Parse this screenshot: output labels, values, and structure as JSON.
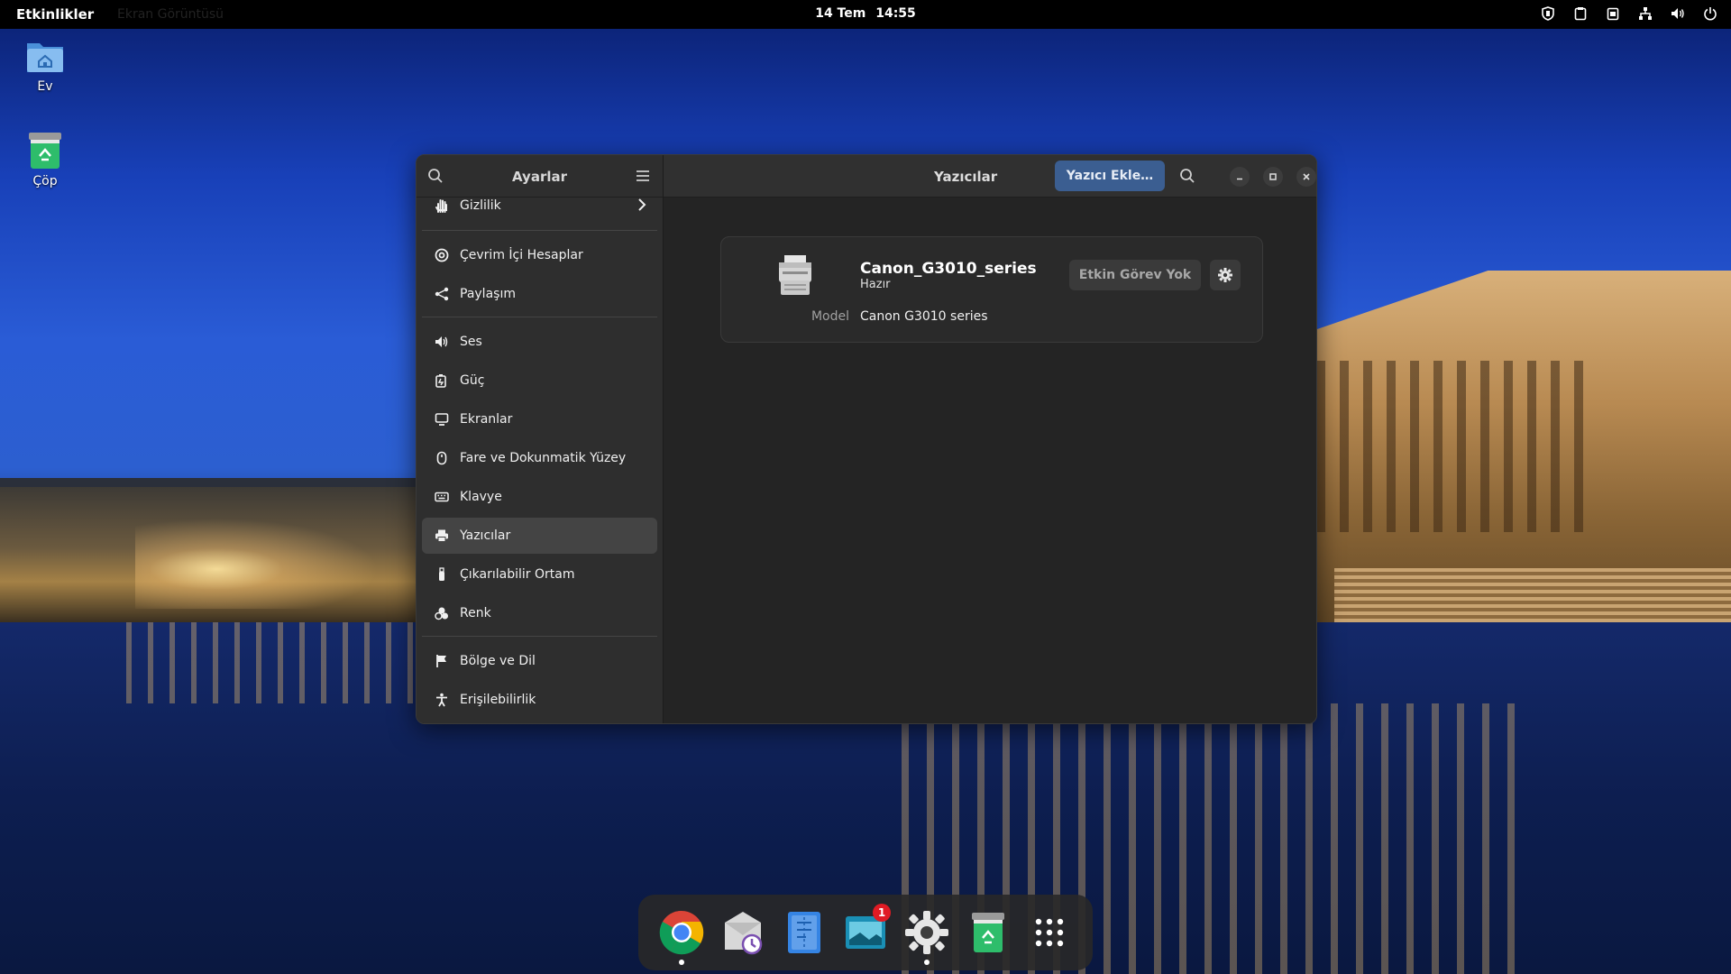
{
  "topbar": {
    "activities": "Etkinlikler",
    "ghost_label": "Ekran Görüntüsü",
    "date": "14 Tem",
    "time": "14:55"
  },
  "desktop": {
    "icons": [
      {
        "label": "Ev",
        "icon": "home-folder-icon"
      },
      {
        "label": "Çöp",
        "icon": "trash-icon"
      }
    ]
  },
  "settings": {
    "sidebar_title": "Ayarlar",
    "items": [
      {
        "label": "Gizlilik",
        "icon": "privacy-hand-icon"
      },
      {
        "label": "Çevrim İçi Hesaplar",
        "icon": "at-icon"
      },
      {
        "label": "Paylaşım",
        "icon": "share-icon"
      },
      {
        "label": "Ses",
        "icon": "speaker-icon"
      },
      {
        "label": "Güç",
        "icon": "battery-icon"
      },
      {
        "label": "Ekranlar",
        "icon": "display-icon"
      },
      {
        "label": "Fare ve Dokunmatik Yüzey",
        "icon": "mouse-icon"
      },
      {
        "label": "Klavye",
        "icon": "keyboard-icon"
      },
      {
        "label": "Yazıcılar",
        "icon": "printer-icon",
        "active": true
      },
      {
        "label": "Çıkarılabilir Ortam",
        "icon": "usb-icon"
      },
      {
        "label": "Renk",
        "icon": "color-icon"
      },
      {
        "label": "Bölge ve Dil",
        "icon": "flag-icon"
      },
      {
        "label": "Erişilebilirlik",
        "icon": "accessibility-icon"
      }
    ],
    "header": {
      "title": "Yazıcılar",
      "add_button": "Yazıcı Ekle…"
    },
    "printer": {
      "name": "Canon_G3010_series",
      "status": "Hazır",
      "jobs_button": "Etkin Görev Yok",
      "model_label": "Model",
      "model_value": "Canon G3010 series"
    }
  },
  "dock": {
    "apps": [
      {
        "name": "chrome-icon"
      },
      {
        "name": "mail-clock-icon"
      },
      {
        "name": "text-editor-icon"
      },
      {
        "name": "image-viewer-icon",
        "badge": "1"
      },
      {
        "name": "settings-gear-icon"
      },
      {
        "name": "trash-icon"
      },
      {
        "name": "app-grid-icon"
      }
    ]
  }
}
